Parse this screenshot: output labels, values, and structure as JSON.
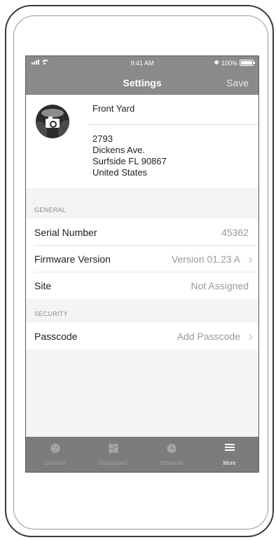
{
  "status_bar": {
    "time": "9:41 AM",
    "bluetooth": "✱",
    "battery_label": "100%"
  },
  "nav": {
    "title": "Settings",
    "save_label": "Save"
  },
  "device": {
    "name": "Front Yard",
    "address": [
      "2793",
      "Dickens Ave.",
      "Surfside FL 90867",
      "United States"
    ]
  },
  "sections": {
    "general": {
      "header": "GENERAL",
      "rows": [
        {
          "label": "Serial Number",
          "value": "45362"
        },
        {
          "label": "Firmware Version",
          "value": "Version 01.23 A"
        },
        {
          "label": "Site",
          "value": "Not Assigned"
        }
      ]
    },
    "security": {
      "header": "SECURITY",
      "rows": [
        {
          "label": "Passcode",
          "value": "Add Passcode"
        }
      ]
    }
  },
  "tabs": [
    {
      "label": "Connect",
      "icon": "connect-icon",
      "active": false
    },
    {
      "label": "Dashboard",
      "icon": "dashboard-icon",
      "active": false
    },
    {
      "label": "Schedule",
      "icon": "schedule-icon",
      "active": false
    },
    {
      "label": "More",
      "icon": "more-icon",
      "active": true
    }
  ],
  "colors": {
    "nav_bar": "#8a8a8a",
    "tab_bar": "#7c7c7c",
    "background": "#f4f4f4",
    "value_text": "#9a9a9a"
  }
}
